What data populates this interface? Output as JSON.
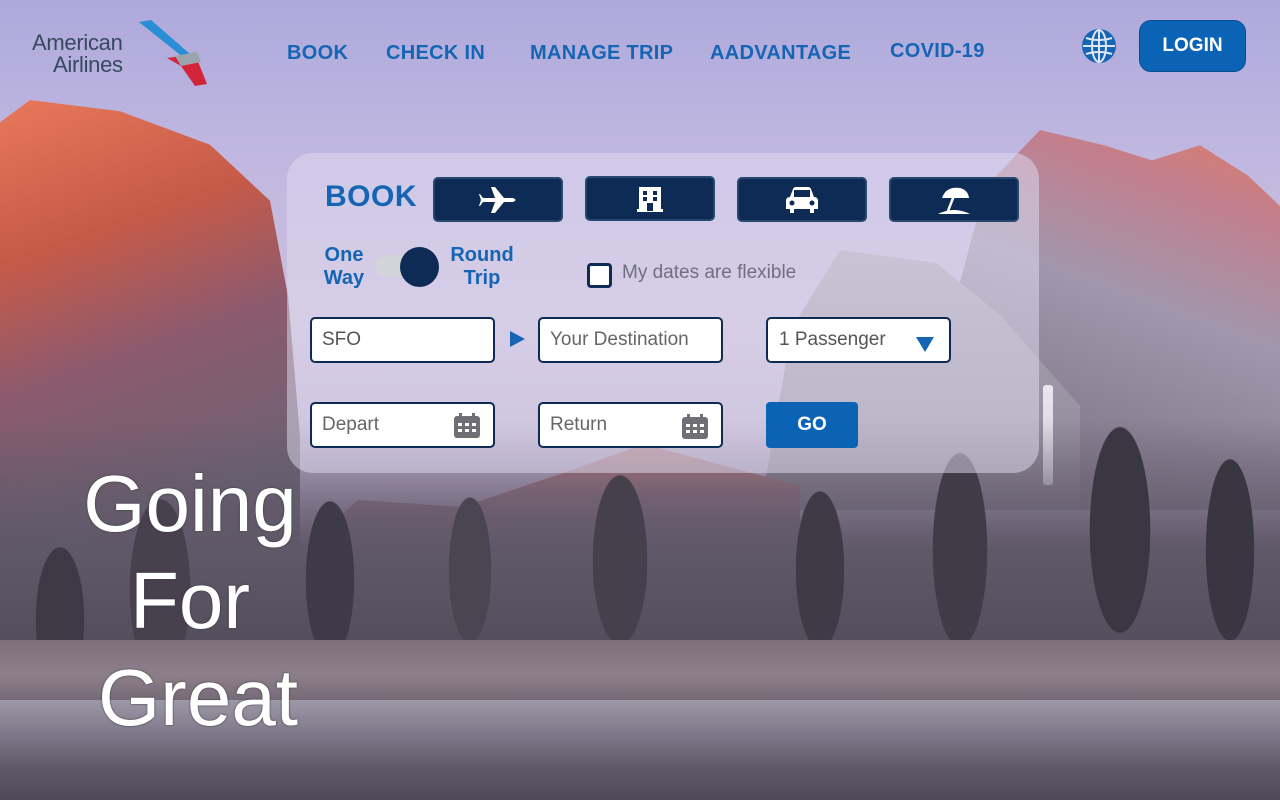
{
  "brand": {
    "line1": "American",
    "line2": "Airlines",
    "colors": {
      "blue": "#1565b4",
      "navy": "#0d2b55",
      "red": "#d3253a"
    }
  },
  "nav": {
    "items": [
      {
        "label": "BOOK"
      },
      {
        "label": "CHECK IN"
      },
      {
        "label": "MANAGE TRIP"
      },
      {
        "label": "AADVANTAGE"
      },
      {
        "label": "COVID-19"
      }
    ],
    "language_icon": "globe-icon",
    "login_label": "LOGIN"
  },
  "booking": {
    "title": "BOOK",
    "categories": [
      {
        "name": "flights",
        "icon": "airplane-icon"
      },
      {
        "name": "hotels",
        "icon": "hotel-icon"
      },
      {
        "name": "cars",
        "icon": "car-icon"
      },
      {
        "name": "vacations",
        "icon": "beach-umbrella-icon"
      }
    ],
    "trip_type": {
      "one_way_line1": "One",
      "one_way_line2": "Way",
      "round_trip_line1": "Round",
      "round_trip_line2": "Trip",
      "selected": "Round Trip"
    },
    "flexible_label": "My dates are flexible",
    "flexible_checked": false,
    "origin_value": "SFO",
    "destination_placeholder": "Your Destination",
    "passengers_value": "1 Passenger",
    "depart_placeholder": "Depart",
    "return_placeholder": "Return",
    "go_label": "GO"
  },
  "hero": {
    "line1": "Going",
    "line2": "For",
    "line3": "Great"
  }
}
